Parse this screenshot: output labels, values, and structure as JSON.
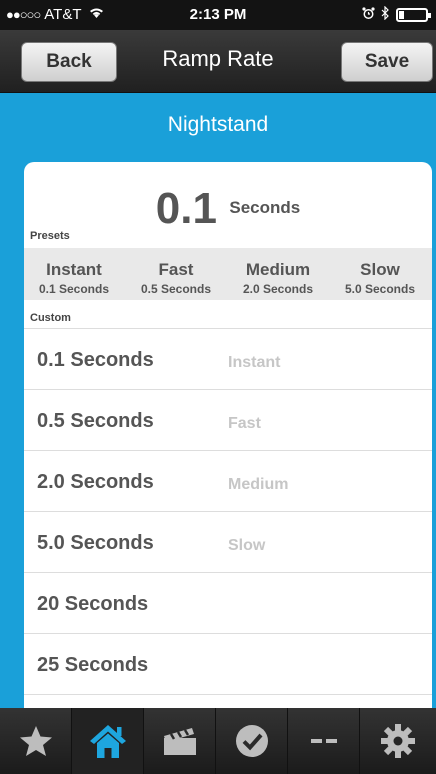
{
  "status_bar": {
    "signal": "●●○○○",
    "carrier": "AT&T",
    "wifi_icon": "wifi-icon",
    "time": "2:13 PM",
    "alarm_icon": "alarm-clock-icon",
    "bluetooth_icon": "bluetooth-icon",
    "battery_icon": "battery-icon"
  },
  "nav": {
    "back_label": "Back",
    "title": "Ramp Rate",
    "save_label": "Save"
  },
  "device_name": "Nightstand",
  "current": {
    "value": "0.1",
    "unit": "Seconds"
  },
  "presets": {
    "label": "Presets",
    "items": [
      {
        "name": "Instant",
        "sub": "0.1 Seconds"
      },
      {
        "name": "Fast",
        "sub": "0.5 Seconds"
      },
      {
        "name": "Medium",
        "sub": "2.0 Seconds"
      },
      {
        "name": "Slow",
        "sub": "5.0 Seconds"
      }
    ]
  },
  "custom": {
    "label": "Custom",
    "items": [
      {
        "value": "0.1 Seconds",
        "desc": "Instant"
      },
      {
        "value": "0.5 Seconds",
        "desc": "Fast"
      },
      {
        "value": "2.0 Seconds",
        "desc": "Medium"
      },
      {
        "value": "5.0 Seconds",
        "desc": "Slow"
      },
      {
        "value": "20 Seconds",
        "desc": ""
      },
      {
        "value": "25 Seconds",
        "desc": ""
      },
      {
        "value": "",
        "desc": ""
      }
    ]
  },
  "tab_bar": {
    "tabs": [
      {
        "icon": "star-icon",
        "active": false
      },
      {
        "icon": "home-icon",
        "active": true
      },
      {
        "icon": "scene-clapper-icon",
        "active": false
      },
      {
        "icon": "checkmark-circle-icon",
        "active": false
      },
      {
        "icon": "dash-icon",
        "active": false
      },
      {
        "icon": "gear-icon",
        "active": false
      }
    ]
  },
  "colors": {
    "background": "#1aa0d9",
    "accent_blue": "#1ea6df",
    "nav_bar": "#2a2a2a",
    "tab_icon": "#bdbdbd"
  }
}
